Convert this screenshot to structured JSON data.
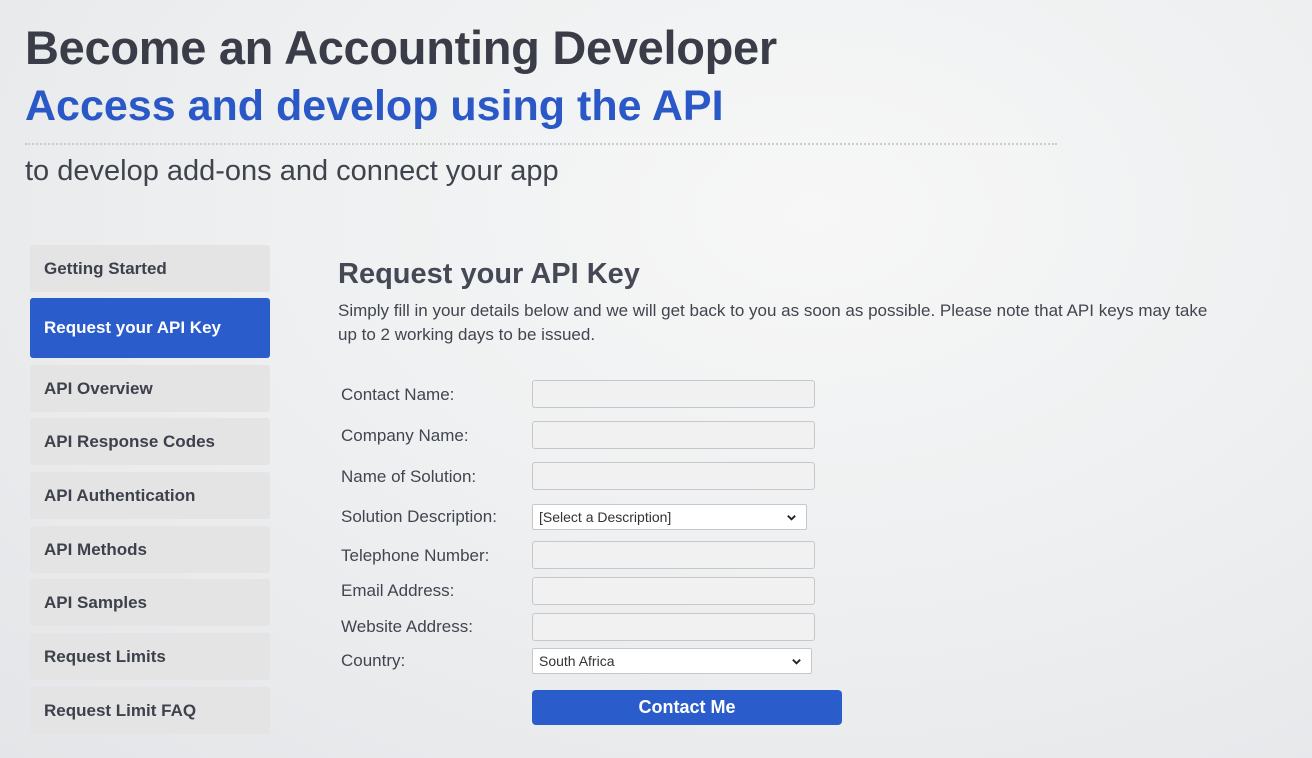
{
  "hero": {
    "title": "Become an Accounting Developer",
    "subtitle": "Access and develop using the API",
    "tagline": "to develop add-ons and connect your app"
  },
  "sidebar": {
    "items": [
      {
        "label": "Getting Started",
        "active": false
      },
      {
        "label": "Request your API Key",
        "active": true
      },
      {
        "label": "API Overview",
        "active": false
      },
      {
        "label": "API Response Codes",
        "active": false
      },
      {
        "label": "API Authentication",
        "active": false
      },
      {
        "label": "API Methods",
        "active": false
      },
      {
        "label": "API Samples",
        "active": false
      },
      {
        "label": "Request Limits",
        "active": false
      },
      {
        "label": "Request Limit FAQ",
        "active": false
      }
    ]
  },
  "content": {
    "title": "Request your API Key",
    "description": "Simply fill in your details below and we will get back to you as soon as possible. Please note that API keys may take up to 2 working days to be issued."
  },
  "form": {
    "contact_name": {
      "label": "Contact Name:",
      "value": ""
    },
    "company_name": {
      "label": "Company Name:",
      "value": ""
    },
    "solution_name": {
      "label": "Name of Solution:",
      "value": ""
    },
    "solution_description": {
      "label": "Solution Description:",
      "selected": "[Select a Description]"
    },
    "telephone": {
      "label": "Telephone Number:",
      "value": ""
    },
    "email": {
      "label": "Email Address:",
      "value": ""
    },
    "website": {
      "label": "Website Address:",
      "value": ""
    },
    "country": {
      "label": "Country:",
      "selected": "South Africa"
    },
    "submit_label": "Contact Me"
  },
  "colors": {
    "accent": "#2a5ccb",
    "sidebar_item_bg": "#e4e4e4",
    "heading": "#3a3d48",
    "subtitle": "#2a58c6"
  },
  "icons": {
    "select_arrow": "chevron-down-icon"
  }
}
